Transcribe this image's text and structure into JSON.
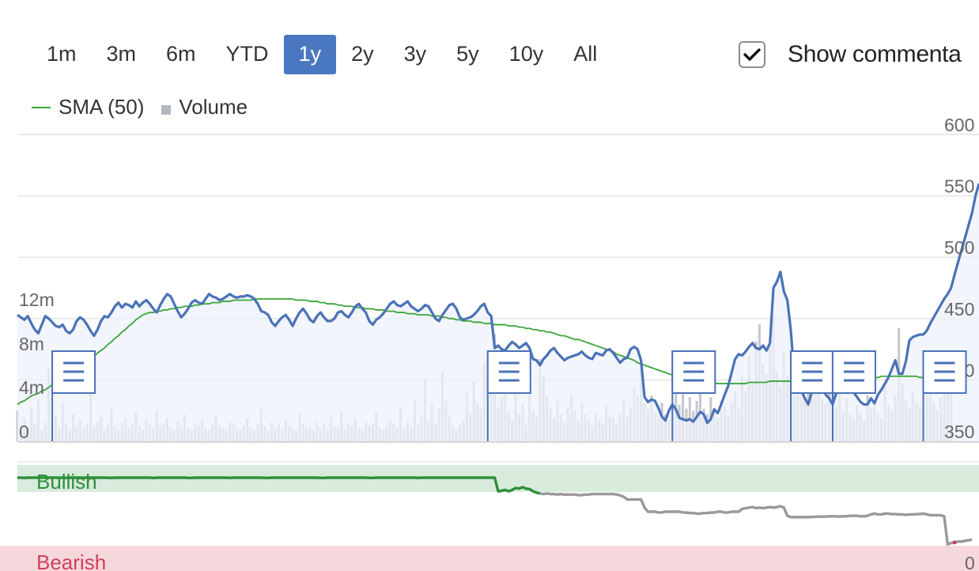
{
  "range_selector": {
    "buttons": [
      "1m",
      "3m",
      "6m",
      "YTD",
      "1y",
      "2y",
      "3y",
      "5y",
      "10y",
      "All"
    ],
    "active": "1y"
  },
  "commentary": {
    "label": "Show commenta",
    "checked": true
  },
  "legend": [
    {
      "name": "SMA (50)",
      "color": "#3aa53a",
      "shape": "line"
    },
    {
      "name": "Volume",
      "color": "#b4b7bf",
      "shape": "square"
    }
  ],
  "colors": {
    "price": "#4a72b8",
    "price_fill": "#eef2fa",
    "sma": "#3aa53a",
    "volume": "#c6c8cf",
    "sentiment_bullish": "#2f8f3a",
    "sentiment_neutral": "#999999",
    "sentiment_bearish": "#d0405a",
    "bullish_band": "#d8ebdc",
    "bearish_band": "#f5d8dc",
    "marker": "#4a72b8"
  },
  "sentiment_labels": {
    "bullish": "Bullish",
    "bearish": "Bearish",
    "axis_zero": "0"
  },
  "chart_data": {
    "type": "line",
    "price": {
      "ylim": [
        350,
        600
      ],
      "ticks": [
        "600",
        "550",
        "500",
        "450",
        "400",
        "350"
      ],
      "values": [
        453,
        451,
        449,
        452,
        446,
        441,
        438,
        445,
        452,
        450,
        447,
        444,
        443,
        445,
        440,
        438,
        441,
        448,
        451,
        449,
        445,
        440,
        436,
        441,
        448,
        452,
        451,
        455,
        460,
        463,
        459,
        462,
        461,
        459,
        464,
        460,
        463,
        465,
        462,
        458,
        455,
        461,
        466,
        470,
        468,
        462,
        456,
        451,
        454,
        458,
        463,
        465,
        463,
        462,
        466,
        470,
        468,
        467,
        465,
        466,
        468,
        470,
        468,
        467,
        468,
        468,
        469,
        468,
        466,
        462,
        456,
        455,
        453,
        447,
        444,
        448,
        451,
        453,
        449,
        444,
        450,
        455,
        458,
        454,
        449,
        447,
        452,
        455,
        451,
        448,
        448,
        450,
        455,
        456,
        453,
        451,
        455,
        460,
        462,
        458,
        455,
        448,
        445,
        449,
        451,
        454,
        458,
        462,
        464,
        461,
        460,
        462,
        464,
        460,
        458,
        456,
        458,
        461,
        460,
        455,
        450,
        448,
        453,
        457,
        461,
        462,
        458,
        451,
        449,
        450,
        451,
        453,
        456,
        460,
        462,
        455,
        452,
        426,
        428,
        425,
        424,
        428,
        431,
        429,
        426,
        428,
        430,
        426,
        417,
        416,
        412,
        417,
        420,
        424,
        426,
        422,
        419,
        416,
        418,
        419,
        420,
        421,
        423,
        420,
        418,
        417,
        422,
        421,
        420,
        424,
        425,
        422,
        418,
        414,
        417,
        418,
        425,
        427,
        425,
        416,
        386,
        382,
        384,
        383,
        377,
        370,
        367,
        375,
        380,
        376,
        369,
        368,
        367,
        368,
        366,
        370,
        374,
        372,
        365,
        368,
        376,
        373,
        380,
        388,
        395,
        406,
        417,
        421,
        420,
        423,
        427,
        430,
        426,
        425,
        428,
        424,
        430,
        475,
        480,
        488,
        472,
        465,
        440,
        403,
        396,
        392,
        385,
        380,
        390,
        399,
        403,
        395,
        388,
        385,
        380,
        389,
        398,
        405,
        401,
        396,
        390,
        386,
        382,
        380,
        380,
        385,
        381,
        388,
        392,
        397,
        402,
        409,
        416,
        405,
        405,
        415,
        432,
        435,
        436,
        437,
        437,
        440,
        446,
        451,
        456,
        461,
        466,
        470,
        475,
        486,
        496,
        506,
        516,
        526,
        536,
        550,
        560
      ]
    },
    "sma": {
      "values": [
        380,
        382,
        383,
        385,
        387,
        388,
        389,
        391,
        392,
        394,
        396,
        398,
        399,
        401,
        403,
        405,
        407,
        409,
        411,
        413,
        415,
        417,
        419,
        422,
        424,
        426,
        429,
        431,
        434,
        436,
        439,
        441,
        444,
        446,
        449,
        451,
        453,
        454,
        455,
        455,
        456,
        456,
        457,
        457,
        458,
        458,
        459,
        459,
        460,
        460,
        460,
        461,
        461,
        462,
        462,
        462,
        463,
        463,
        463,
        464,
        464,
        464,
        465,
        465,
        465,
        465,
        465,
        465,
        466,
        466,
        466,
        466,
        466,
        466,
        466,
        466,
        466,
        466,
        466,
        466,
        465,
        465,
        465,
        465,
        464,
        464,
        464,
        463,
        463,
        462,
        462,
        462,
        461,
        461,
        460,
        460,
        460,
        459,
        459,
        459,
        458,
        458,
        458,
        457,
        457,
        457,
        456,
        456,
        456,
        455,
        455,
        455,
        454,
        454,
        454,
        453,
        453,
        453,
        453,
        452,
        452,
        452,
        451,
        451,
        450,
        450,
        449,
        449,
        448,
        448,
        448,
        447,
        447,
        447,
        446,
        446,
        446,
        445,
        445,
        445,
        445,
        444,
        444,
        444,
        443,
        443,
        442,
        442,
        441,
        441,
        440,
        440,
        439,
        439,
        438,
        437,
        436,
        436,
        435,
        434,
        433,
        433,
        432,
        431,
        430,
        429,
        428,
        427,
        426,
        425,
        424,
        423,
        421,
        420,
        419,
        418,
        417,
        416,
        414,
        413,
        412,
        411,
        410,
        409,
        408,
        407,
        406,
        405,
        404,
        403,
        402,
        402,
        401,
        401,
        400,
        400,
        399,
        399,
        398,
        398,
        398,
        397,
        397,
        397,
        397,
        397,
        397,
        397,
        397,
        397,
        398,
        398,
        398,
        398,
        398,
        398,
        399,
        399,
        399,
        399,
        399,
        399,
        399,
        399,
        399,
        399,
        399,
        399,
        399,
        400,
        400,
        400,
        400,
        400,
        400,
        400,
        400,
        401,
        401,
        401,
        401,
        401,
        402,
        402,
        402,
        402,
        402,
        402,
        403,
        403,
        403,
        403,
        403,
        403,
        403,
        403,
        403,
        403,
        403,
        402,
        402,
        402,
        401,
        401,
        401,
        401,
        401
      ]
    },
    "volume": {
      "ylim": [
        0,
        16000000
      ],
      "ticks": [
        "12m",
        "8m",
        "4m",
        "0"
      ],
      "values": [
        1.6,
        0.8,
        1.2,
        0.7,
        1.8,
        0.9,
        2.2,
        0.6,
        1.0,
        3.8,
        0.8,
        1.3,
        0.7,
        2.0,
        0.9,
        0.6,
        1.4,
        0.8,
        1.1,
        0.7,
        0.9,
        2.5,
        0.8,
        1.0,
        1.3,
        0.6,
        0.9,
        1.7,
        0.8,
        0.6,
        1.0,
        1.2,
        0.7,
        0.9,
        1.5,
        0.8,
        0.6,
        1.1,
        0.9,
        0.7,
        1.6,
        0.8,
        0.9,
        1.2,
        0.7,
        0.6,
        1.0,
        0.8,
        1.4,
        0.7,
        0.6,
        0.9,
        0.8,
        1.1,
        0.7,
        0.6,
        0.9,
        1.3,
        0.8,
        0.7,
        0.6,
        1.0,
        0.9,
        0.7,
        0.6,
        0.8,
        1.2,
        0.7,
        0.6,
        0.9,
        1.7,
        0.8,
        0.6,
        1.0,
        0.7,
        0.9,
        0.6,
        1.1,
        0.8,
        0.7,
        0.6,
        1.4,
        0.9,
        0.7,
        0.8,
        0.6,
        1.0,
        0.7,
        0.9,
        0.6,
        1.3,
        0.8,
        0.7,
        1.6,
        0.6,
        0.9,
        0.8,
        1.2,
        0.7,
        0.6,
        1.0,
        0.8,
        0.9,
        1.5,
        0.7,
        0.6,
        0.8,
        1.1,
        0.9,
        0.7,
        1.8,
        0.6,
        1.0,
        0.8,
        2.2,
        0.9,
        1.3,
        3.2,
        1.0,
        2.0,
        0.9,
        1.7,
        3.6,
        2.1,
        1.3,
        0.8,
        0.6,
        0.9,
        1.1,
        2.6,
        1.4,
        3.1,
        2.0,
        1.7,
        4.1,
        2.6,
        3.1,
        5.6,
        1.8,
        2.3,
        4.6,
        1.6,
        1.1,
        2.7,
        1.4,
        1.9,
        0.9,
        2.9,
        1.6,
        1.3,
        4.3,
        3.4,
        2.4,
        1.7,
        1.2,
        2.1,
        1.4,
        1.0,
        1.8,
        2.4,
        1.6,
        1.1,
        2.0,
        1.4,
        1.1,
        0.8,
        1.5,
        1.1,
        0.9,
        1.9,
        1.3,
        1.2,
        0.9,
        1.4,
        2.2,
        1.3,
        1.8,
        2.9,
        2.4,
        4.1,
        2.0,
        1.7,
        2.4,
        1.5,
        1.3,
        2.0,
        1.4,
        1.1,
        1.8,
        2.6,
        1.9,
        2.6,
        1.7,
        2.3,
        1.6,
        2.1,
        2.9,
        1.7,
        1.4,
        2.3,
        1.6,
        1.2,
        2.1,
        1.8,
        1.4,
        2.0,
        2.6,
        1.7,
        3.4,
        2.6,
        4.4,
        3.1,
        5.2,
        6.1,
        4.0,
        3.5,
        5.0,
        6.5,
        3.6,
        2.9,
        4.6,
        3.4,
        3.0,
        2.4,
        3.9,
        4.7,
        2.3,
        2.9,
        4.0,
        2.6,
        3.4,
        2.2,
        2.0,
        2.6,
        3.6,
        1.8,
        2.6,
        1.6,
        2.2,
        1.4,
        1.2,
        1.9,
        1.5,
        1.1,
        2.4,
        1.7,
        2.1,
        1.4,
        1.2,
        2.8,
        1.9,
        1.6,
        2.4,
        5.9,
        3.0,
        2.1,
        1.7,
        2.6,
        2.0,
        1.8,
        1.5,
        2.4,
        3.1,
        2.0,
        1.6,
        2.3,
        2.8,
        3.3,
        2.6
      ]
    },
    "sentiment": {
      "categories": [
        "Bullish",
        "Bearish"
      ],
      "values": [
        5.0,
        5.0,
        4.99,
        5.0,
        5.0,
        5.0,
        5.0,
        5.0,
        5.0,
        5.0,
        5.0,
        5.0,
        5.0,
        5.0,
        4.99,
        5.0,
        5.0,
        5.0,
        5.0,
        5.0,
        5.0,
        5.0,
        5.0,
        5.0,
        5.0,
        5.0,
        5.0,
        4.99,
        5.0,
        5.0,
        5.0,
        5.0,
        5.0,
        5.0,
        5.0,
        5.0,
        5.0,
        5.0,
        5.0,
        4.99,
        5.0,
        5.0,
        5.0,
        5.0,
        5.0,
        5.0,
        5.0,
        5.0,
        5.0,
        4.99,
        4.99,
        5.0,
        5.0,
        5.0,
        5.0,
        5.0,
        5.0,
        5.0,
        5.0,
        5.0,
        5.0,
        4.99,
        5.0,
        5.0,
        5.0,
        5.0,
        5.0,
        5.0,
        5.0,
        5.0,
        5.0,
        4.99,
        4.99,
        5.0,
        5.0,
        5.0,
        5.0,
        5.0,
        5.0,
        5.0,
        5.0,
        5.0,
        5.0,
        5.0,
        5.0,
        5.0,
        5.0,
        4.99,
        4.99,
        5.0,
        5.0,
        5.0,
        5.0,
        5.0,
        5.0,
        5.0,
        5.0,
        5.0,
        5.0,
        5.0,
        5.0,
        4.99,
        4.99,
        5.0,
        5.0,
        5.0,
        5.0,
        5.0,
        5.0,
        5.0,
        5.0,
        5.0,
        5.0,
        5.0,
        5.0,
        4.99,
        5.0,
        5.0,
        5.0,
        5.0,
        5.0,
        5.0,
        5.0,
        5.0,
        5.0,
        5.0,
        5.0,
        5.0,
        5.0,
        5.0,
        5.0,
        5.0,
        5.0,
        5.0,
        5.0,
        5.0,
        5.0,
        5.0,
        4.5,
        4.52,
        4.55,
        4.5,
        4.55,
        4.62,
        4.6,
        4.65,
        4.6,
        4.58,
        4.5,
        4.45,
        4.42,
        4.4,
        4.42,
        4.4,
        4.4,
        4.38,
        4.4,
        4.38,
        4.38,
        4.38,
        4.38,
        4.36,
        4.36,
        4.38,
        4.38,
        4.4,
        4.4,
        4.4,
        4.4,
        4.4,
        4.4,
        4.4,
        4.38,
        4.35,
        4.3,
        4.2,
        4.2,
        4.2,
        4.2,
        4.2,
        3.9,
        3.75,
        3.75,
        3.75,
        3.72,
        3.72,
        3.75,
        3.75,
        3.75,
        3.75,
        3.75,
        3.72,
        3.72,
        3.7,
        3.7,
        3.68,
        3.68,
        3.7,
        3.7,
        3.72,
        3.72,
        3.75,
        3.75,
        3.72,
        3.72,
        3.75,
        3.75,
        3.75,
        3.85,
        3.88,
        3.9,
        3.92,
        3.88,
        3.9,
        3.88,
        3.9,
        3.92,
        3.9,
        3.92,
        3.95,
        3.9,
        3.6,
        3.55,
        3.55,
        3.55,
        3.55,
        3.55,
        3.55,
        3.56,
        3.56,
        3.57,
        3.57,
        3.57,
        3.58,
        3.58,
        3.58,
        3.57,
        3.58,
        3.58,
        3.6,
        3.6,
        3.6,
        3.58,
        3.58,
        3.6,
        3.65,
        3.68,
        3.65,
        3.65,
        3.68,
        3.68,
        3.66,
        3.66,
        3.65,
        3.65,
        3.63,
        3.65,
        3.65,
        3.66,
        3.66,
        3.68,
        3.65,
        3.62,
        3.62,
        3.62,
        3.62,
        3.58,
        2.55,
        2.6,
        2.62,
        2.65,
        2.65,
        2.68,
        2.7,
        2.72
      ]
    },
    "commentary_markers_at_index": [
      10,
      135,
      188,
      222,
      234,
      260
    ]
  }
}
